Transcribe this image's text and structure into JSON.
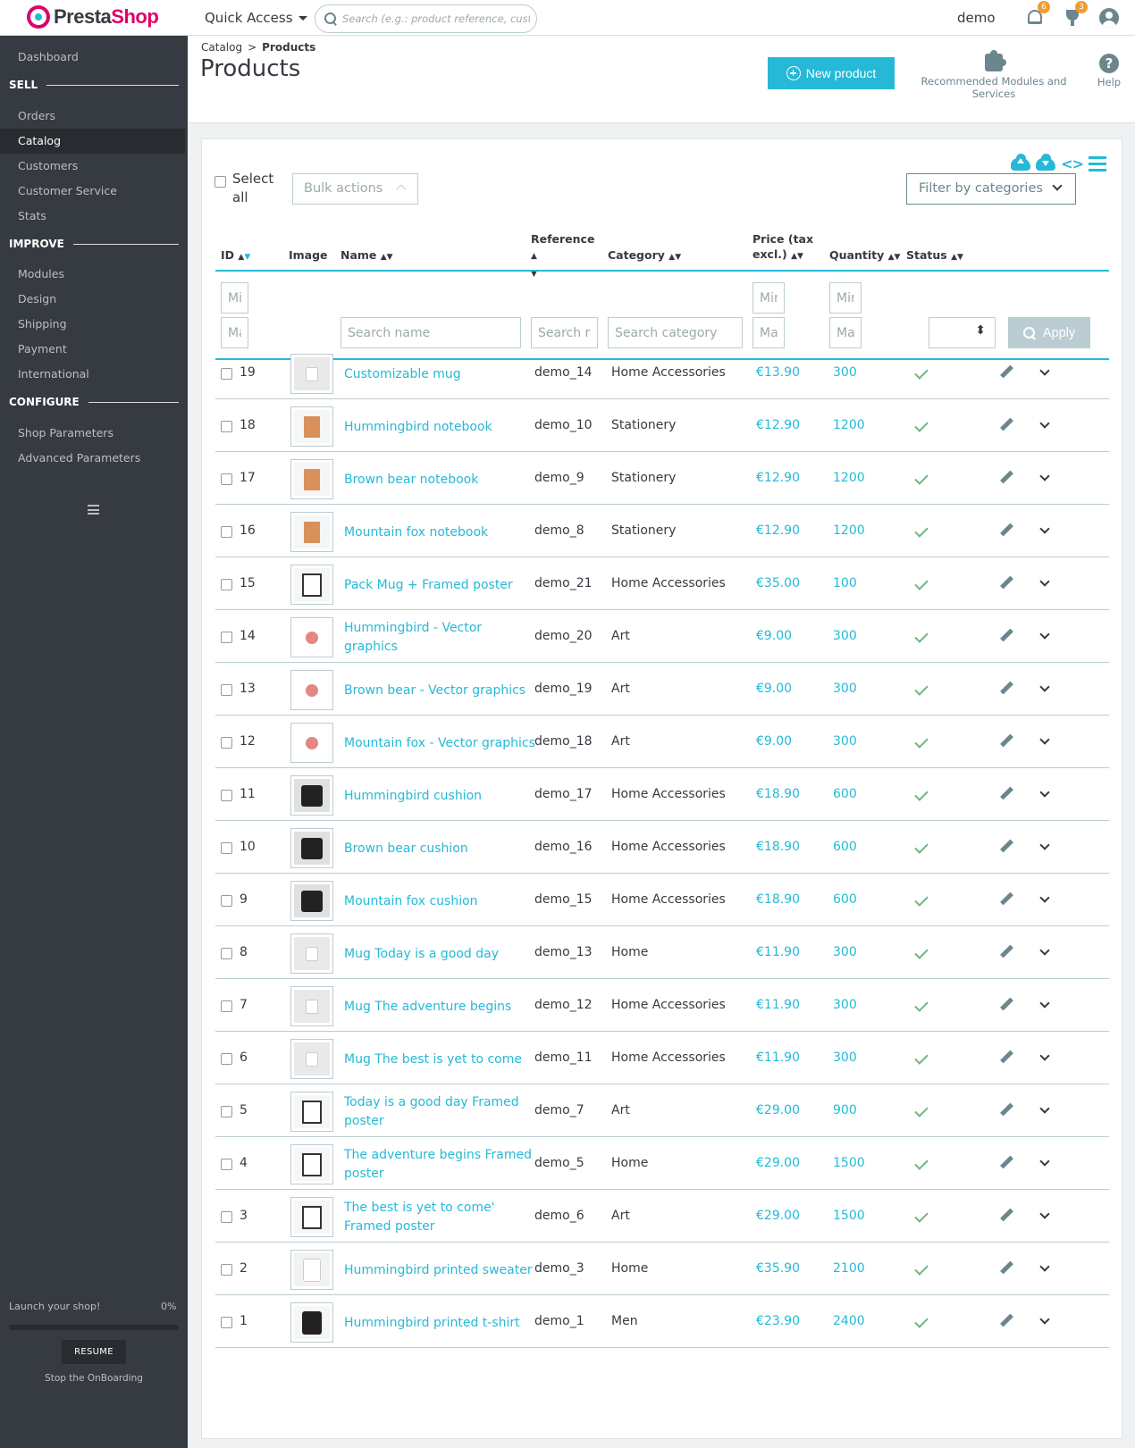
{
  "header": {
    "brand_a": "Presta",
    "brand_b": "Shop",
    "quick_access": "Quick Access",
    "search_placeholder": "Search (e.g.: product reference, customer name...)",
    "employee": "demo",
    "notifications_count": "6",
    "orders_count": "3"
  },
  "sidebar": {
    "dashboard": "Dashboard",
    "sections": [
      {
        "title": "SELL",
        "items": [
          "Orders",
          "Catalog",
          "Customers",
          "Customer Service",
          "Stats"
        ]
      },
      {
        "title": "IMPROVE",
        "items": [
          "Modules",
          "Design",
          "Shipping",
          "Payment",
          "International"
        ]
      },
      {
        "title": "CONFIGURE",
        "items": [
          "Shop Parameters",
          "Advanced Parameters"
        ]
      }
    ],
    "active_item": "Catalog",
    "onboarding": {
      "title": "Launch your shop!",
      "progress": "0%",
      "resume": "RESUME",
      "stop": "Stop the OnBoarding"
    }
  },
  "toolbar": {
    "breadcrumb_parent": "Catalog",
    "breadcrumb_sep": ">",
    "breadcrumb_current": "Products",
    "title": "Products",
    "new_product": "New product",
    "recommended": "Recommended Modules and Services",
    "help": "Help"
  },
  "list": {
    "select_all": "Select all",
    "bulk_actions": "Bulk actions",
    "filter_by_categories": "Filter by categories",
    "columns": {
      "id": "ID",
      "image": "Image",
      "name": "Name",
      "reference": "Reference",
      "category": "Category",
      "price": "Price (tax excl.)",
      "quantity": "Quantity",
      "status": "Status"
    },
    "filters": {
      "id_min": "Min",
      "id_max": "Max",
      "name": "Search name",
      "reference": "Search ref.",
      "category": "Search category",
      "price_min": "Min",
      "price_max": "Max",
      "qty_min": "Min",
      "qty_max": "Max",
      "apply": "Apply"
    },
    "rows": [
      {
        "id": "19",
        "name": "Customizable mug",
        "ref": "demo_14",
        "cat": "Home Accessories",
        "price": "€13.90",
        "qty": "300",
        "thumb": "mug"
      },
      {
        "id": "18",
        "name": "Hummingbird notebook",
        "ref": "demo_10",
        "cat": "Stationery",
        "price": "€12.90",
        "qty": "1200",
        "thumb": "notebook"
      },
      {
        "id": "17",
        "name": "Brown bear notebook",
        "ref": "demo_9",
        "cat": "Stationery",
        "price": "€12.90",
        "qty": "1200",
        "thumb": "notebook"
      },
      {
        "id": "16",
        "name": "Mountain fox notebook",
        "ref": "demo_8",
        "cat": "Stationery",
        "price": "€12.90",
        "qty": "1200",
        "thumb": "notebook"
      },
      {
        "id": "15",
        "name": "Pack Mug + Framed poster",
        "ref": "demo_21",
        "cat": "Home Accessories",
        "price": "€35.00",
        "qty": "100",
        "thumb": "frame"
      },
      {
        "id": "14",
        "name": "Hummingbird - Vector graphics",
        "ref": "demo_20",
        "cat": "Art",
        "price": "€9.00",
        "qty": "300",
        "thumb": "vector"
      },
      {
        "id": "13",
        "name": "Brown bear - Vector graphics",
        "ref": "demo_19",
        "cat": "Art",
        "price": "€9.00",
        "qty": "300",
        "thumb": "vector"
      },
      {
        "id": "12",
        "name": "Mountain fox - Vector graphics",
        "ref": "demo_18",
        "cat": "Art",
        "price": "€9.00",
        "qty": "300",
        "thumb": "vector"
      },
      {
        "id": "11",
        "name": "Hummingbird cushion",
        "ref": "demo_17",
        "cat": "Home Accessories",
        "price": "€18.90",
        "qty": "600",
        "thumb": "cushion"
      },
      {
        "id": "10",
        "name": "Brown bear cushion",
        "ref": "demo_16",
        "cat": "Home Accessories",
        "price": "€18.90",
        "qty": "600",
        "thumb": "cushion"
      },
      {
        "id": "9",
        "name": "Mountain fox cushion",
        "ref": "demo_15",
        "cat": "Home Accessories",
        "price": "€18.90",
        "qty": "600",
        "thumb": "cushion"
      },
      {
        "id": "8",
        "name": "Mug Today is a good day",
        "ref": "demo_13",
        "cat": "Home",
        "price": "€11.90",
        "qty": "300",
        "thumb": "mug"
      },
      {
        "id": "7",
        "name": "Mug The adventure begins",
        "ref": "demo_12",
        "cat": "Home Accessories",
        "price": "€11.90",
        "qty": "300",
        "thumb": "mug"
      },
      {
        "id": "6",
        "name": "Mug The best is yet to come",
        "ref": "demo_11",
        "cat": "Home Accessories",
        "price": "€11.90",
        "qty": "300",
        "thumb": "mug"
      },
      {
        "id": "5",
        "name": "Today is a good day Framed poster",
        "ref": "demo_7",
        "cat": "Art",
        "price": "€29.00",
        "qty": "900",
        "thumb": "frame"
      },
      {
        "id": "4",
        "name": "The adventure begins Framed poster",
        "ref": "demo_5",
        "cat": "Home",
        "price": "€29.00",
        "qty": "1500",
        "thumb": "frame"
      },
      {
        "id": "3",
        "name": "The best is yet to come' Framed poster",
        "ref": "demo_6",
        "cat": "Art",
        "price": "€29.00",
        "qty": "1500",
        "thumb": "frame"
      },
      {
        "id": "2",
        "name": "Hummingbird printed sweater",
        "ref": "demo_3",
        "cat": "Home",
        "price": "€35.90",
        "qty": "2100",
        "thumb": "sweater"
      },
      {
        "id": "1",
        "name": "Hummingbird printed t-shirt",
        "ref": "demo_1",
        "cat": "Men",
        "price": "€23.90",
        "qty": "2400",
        "thumb": "tshirt"
      }
    ]
  },
  "colors": {
    "accent": "#25b9d7",
    "sidebar": "#363a41",
    "success": "#70b580",
    "brand_pink": "#df0067",
    "badge": "#f19c32"
  }
}
